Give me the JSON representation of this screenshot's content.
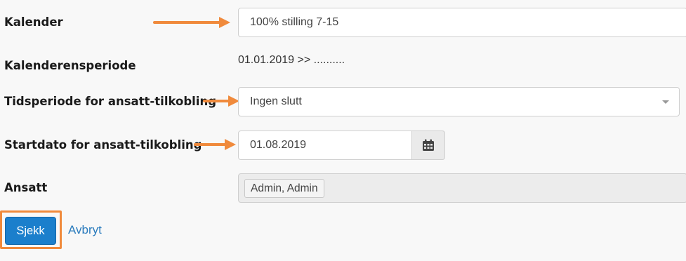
{
  "form": {
    "calendar": {
      "label": "Kalender",
      "value": "100% stilling 7-15"
    },
    "calendar_period": {
      "label": "Kalenderensperiode",
      "value": "01.01.2019 >> .........."
    },
    "time_period": {
      "label": "Tidsperiode for ansatt-tilkobling",
      "selected": "Ingen slutt"
    },
    "start_date": {
      "label": "Startdato for ansatt-tilkobling",
      "value": "01.08.2019",
      "button_icon": "calendar-icon"
    },
    "employee": {
      "label": "Ansatt",
      "tags": [
        "Admin, Admin"
      ]
    }
  },
  "actions": {
    "submit_label": "Sjekk",
    "cancel_label": "Avbryt"
  },
  "annotations": {
    "arrow_color": "#f08a3c",
    "highlight_color": "#f08a3c"
  },
  "colors": {
    "primary": "#1b7fcc",
    "link": "#2a7bbd",
    "background": "#f8f8f8"
  }
}
